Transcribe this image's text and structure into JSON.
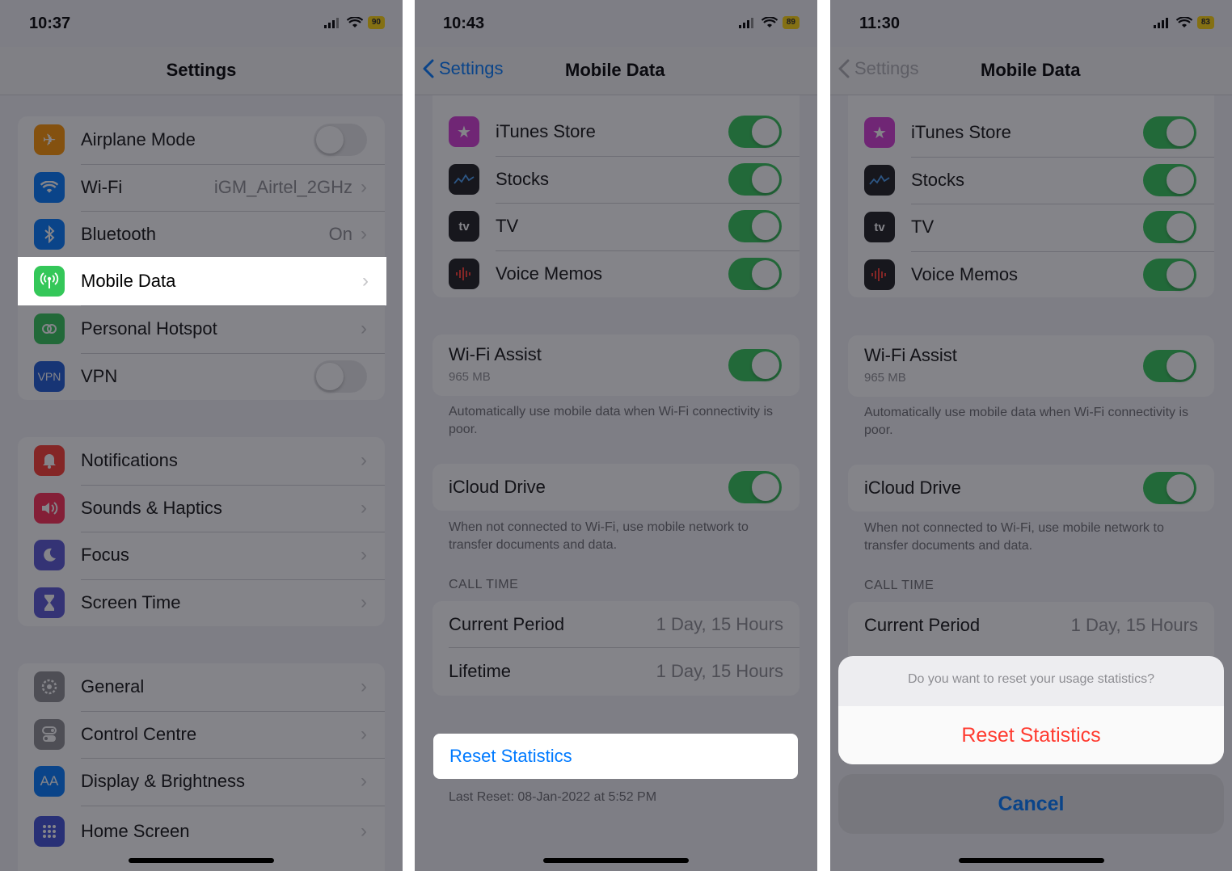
{
  "screen1": {
    "time": "10:37",
    "battery": "90",
    "title": "Settings",
    "group1": [
      {
        "label": "Airplane Mode",
        "icon": "airplane-icon",
        "color": "#ff9500",
        "control": "toggle-off"
      },
      {
        "label": "Wi-Fi",
        "value": "iGM_Airtel_2GHz",
        "icon": "wifi-icon",
        "color": "#007aff",
        "control": "chevron"
      },
      {
        "label": "Bluetooth",
        "value": "On",
        "icon": "bluetooth-icon",
        "color": "#007aff",
        "control": "chevron"
      },
      {
        "label": "Mobile Data",
        "icon": "antenna-icon",
        "color": "#34c759",
        "control": "chevron",
        "highlighted": true
      },
      {
        "label": "Personal Hotspot",
        "icon": "hotspot-icon",
        "color": "#34c759",
        "control": "chevron"
      },
      {
        "label": "VPN",
        "icon": "vpn-icon",
        "icon_text": "VPN",
        "color": "#1d5bd6",
        "control": "toggle-off"
      }
    ],
    "group2": [
      {
        "label": "Notifications",
        "icon": "bell-icon",
        "color": "#ff3b30"
      },
      {
        "label": "Sounds & Haptics",
        "icon": "speaker-icon",
        "color": "#ff2d55"
      },
      {
        "label": "Focus",
        "icon": "moon-icon",
        "color": "#5856d6"
      },
      {
        "label": "Screen Time",
        "icon": "hourglass-icon",
        "color": "#5856d6"
      }
    ],
    "group3": [
      {
        "label": "General",
        "icon": "gear-icon",
        "color": "#8e8e93"
      },
      {
        "label": "Control Centre",
        "icon": "switches-icon",
        "color": "#8e8e93"
      },
      {
        "label": "Display & Brightness",
        "icon": "aa-icon",
        "icon_text": "AA",
        "color": "#007aff"
      },
      {
        "label": "Home Screen",
        "icon": "grid-icon",
        "color": "#3f51d8"
      }
    ]
  },
  "screen2": {
    "time": "10:43",
    "battery": "89",
    "back_label": "Settings",
    "title": "Mobile Data",
    "apps": [
      {
        "label": "iTunes Store",
        "icon": "star-icon",
        "color": "#d63cd6"
      },
      {
        "label": "Stocks",
        "icon": "stocks-icon",
        "color": "#1c1c1e"
      },
      {
        "label": "TV",
        "icon": "tv-icon",
        "icon_text": "tv",
        "color": "#1c1c1e"
      },
      {
        "label": "Voice Memos",
        "icon": "waveform-icon",
        "color": "#1c1c1e"
      }
    ],
    "wifi_assist": {
      "label": "Wi-Fi Assist",
      "sub": "965 MB",
      "footnote": "Automatically use mobile data when Wi-Fi connectivity is poor."
    },
    "icloud": {
      "label": "iCloud Drive",
      "footnote": "When not connected to Wi-Fi, use mobile network to transfer documents and data."
    },
    "call_time": {
      "header": "CALL TIME",
      "current_label": "Current Period",
      "current_value": "1 Day, 15 Hours",
      "lifetime_label": "Lifetime",
      "lifetime_value": "1 Day, 15 Hours"
    },
    "reset_label": "Reset Statistics",
    "last_reset": "Last Reset: 08-Jan-2022 at 5:52 PM"
  },
  "screen3": {
    "time": "11:30",
    "battery": "83",
    "back_label": "Settings",
    "title": "Mobile Data",
    "apps": [
      {
        "label": "iTunes Store",
        "icon": "star-icon",
        "color": "#d63cd6"
      },
      {
        "label": "Stocks",
        "icon": "stocks-icon",
        "color": "#1c1c1e"
      },
      {
        "label": "TV",
        "icon": "tv-icon",
        "icon_text": "tv",
        "color": "#1c1c1e"
      },
      {
        "label": "Voice Memos",
        "icon": "waveform-icon",
        "color": "#1c1c1e"
      }
    ],
    "wifi_assist": {
      "label": "Wi-Fi Assist",
      "sub": "965 MB",
      "footnote": "Automatically use mobile data when Wi-Fi connectivity is poor."
    },
    "icloud": {
      "label": "iCloud Drive",
      "footnote": "When not connected to Wi-Fi, use mobile network to transfer documents and data."
    },
    "call_time": {
      "header": "CALL TIME",
      "current_label": "Current Period",
      "current_value": "1 Day, 15 Hours"
    },
    "sheet": {
      "question": "Do you want to reset your usage statistics?",
      "confirm": "Reset Statistics",
      "cancel": "Cancel"
    }
  },
  "colors": {
    "accent": "#007aff",
    "destructive": "#ff3b30",
    "toggle_on": "#34c759"
  }
}
